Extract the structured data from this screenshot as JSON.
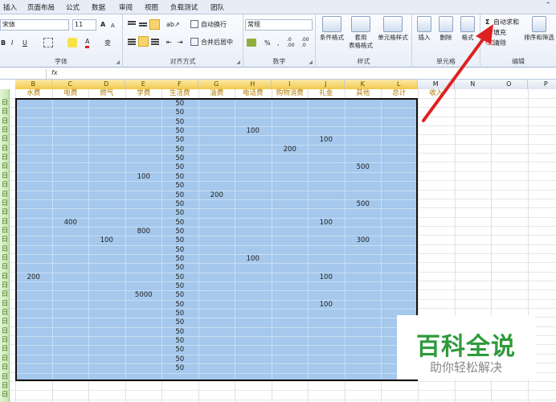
{
  "menu": {
    "tabs": [
      "插入",
      "页面布局",
      "公式",
      "数据",
      "审阅",
      "视图",
      "负载测试",
      "团队"
    ],
    "help_icon": "chevron-up-icon"
  },
  "ribbon": {
    "font": {
      "name": "宋体",
      "size": "11",
      "grow": "A",
      "shrink": "A",
      "bold": "B",
      "italic": "I",
      "underline": "U",
      "border_icon": "border-icon",
      "fill_icon": "fill-color-icon",
      "font_color": "A",
      "phonetic": "变",
      "group_label": "字体"
    },
    "alignment": {
      "wrap": "自动换行",
      "merge": "合并后居中",
      "group_label": "对齐方式"
    },
    "number": {
      "format": "常规",
      "percent": "%",
      "comma": ",",
      "inc_decimal": ".0 .00",
      "dec_decimal": ".00 .0",
      "group_label": "数字"
    },
    "styles": {
      "conditional": "条件格式",
      "table_line1": "套用",
      "table_line2": "表格格式",
      "cell_styles": "单元格样式",
      "group_label": "样式"
    },
    "cells": {
      "insert": "插入",
      "delete": "删除",
      "format": "格式",
      "group_label": "单元格"
    },
    "editing": {
      "autosum": "自动求和",
      "fill": "填充",
      "clear": "清除",
      "sort": "排序和筛选",
      "group_label": "编辑"
    }
  },
  "formula_bar": {
    "fx": "fx",
    "formula": ""
  },
  "columns": [
    "B",
    "C",
    "D",
    "E",
    "F",
    "G",
    "H",
    "I",
    "J",
    "K",
    "L",
    "M",
    "N",
    "O",
    "P"
  ],
  "sheet_headers": [
    "水费",
    "电费",
    "燃气",
    "学费",
    "生活费",
    "油费",
    "电话费",
    "购物消费",
    "礼金",
    "其他",
    "总计",
    "收入"
  ],
  "row_label": "日",
  "rows": [
    {
      "F": "50"
    },
    {
      "F": "50"
    },
    {
      "F": "50"
    },
    {
      "F": "50",
      "H": "100"
    },
    {
      "F": "50",
      "J": "100"
    },
    {
      "F": "50",
      "I": "200"
    },
    {
      "F": "50"
    },
    {
      "F": "50",
      "K": "500"
    },
    {
      "E": "100",
      "F": "50"
    },
    {
      "F": "50"
    },
    {
      "F": "50",
      "G": "200"
    },
    {
      "F": "50",
      "K": "500"
    },
    {
      "F": "50"
    },
    {
      "C": "400",
      "F": "50",
      "J": "100"
    },
    {
      "E": "800",
      "F": "50"
    },
    {
      "D": "100",
      "F": "50",
      "K": "300"
    },
    {
      "F": "50"
    },
    {
      "F": "50",
      "H": "100"
    },
    {
      "F": "50"
    },
    {
      "B": "200",
      "F": "50",
      "J": "100"
    },
    {
      "F": "50"
    },
    {
      "E": "5000",
      "F": "50"
    },
    {
      "F": "50",
      "J": "100"
    },
    {
      "F": "50"
    },
    {
      "F": "50"
    },
    {
      "F": "50"
    },
    {
      "F": "50"
    },
    {
      "F": "50"
    },
    {
      "F": "50"
    },
    {
      "F": "50"
    },
    {}
  ],
  "watermark": {
    "title": "百科全说",
    "subtitle": "助你轻松解决"
  },
  "colors": {
    "selection_fill": "#a5c8ec",
    "header_text": "#b07a00",
    "arrow": "#e02020",
    "watermark_green": "#2f9a3b"
  }
}
